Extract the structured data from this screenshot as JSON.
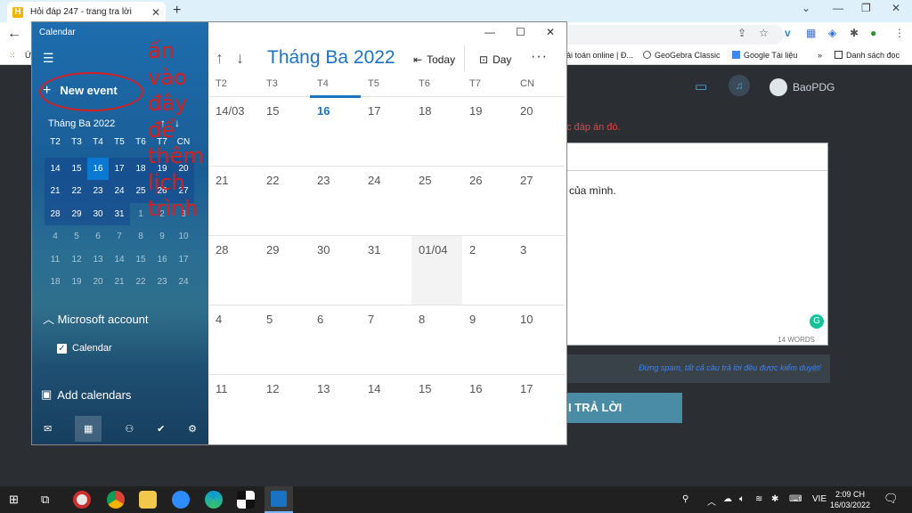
{
  "browser": {
    "tab_title": "Hỏi đáp 247 - trang tra lời",
    "bookmarks": [
      "Ứ",
      "ải toán online | Đ...",
      "GeoGebra Classic",
      "Google Tài liệu",
      "Danh sách đọc"
    ],
    "more_bookmarks": "»"
  },
  "website": {
    "username": "BaoPDG",
    "red_notice": "c đáp án đó.",
    "editor_text": "của mình.",
    "word_count": "14 WORDS",
    "spam_notice": "Đừng spam, tất cả câu trả lời đều được kiểm duyệt!",
    "submit_label": "I TRẢ LỜI"
  },
  "calendar": {
    "app_title": "Calendar",
    "new_event_label": "New event",
    "mini_month_title": "Tháng Ba 2022",
    "weekdays": [
      "T2",
      "T3",
      "T4",
      "T5",
      "T6",
      "T7",
      "CN"
    ],
    "mini_weeks": [
      [
        "14",
        "15",
        "16",
        "17",
        "18",
        "19",
        "20"
      ],
      [
        "21",
        "22",
        "23",
        "24",
        "25",
        "26",
        "27"
      ],
      [
        "28",
        "29",
        "30",
        "31",
        "1",
        "2",
        "3"
      ],
      [
        "4",
        "5",
        "6",
        "7",
        "8",
        "9",
        "10"
      ],
      [
        "11",
        "12",
        "13",
        "14",
        "15",
        "16",
        "17"
      ],
      [
        "18",
        "19",
        "20",
        "21",
        "22",
        "23",
        "24"
      ]
    ],
    "account_label": "Microsoft account",
    "calendar_item": "Calendar",
    "add_calendars": "Add calendars",
    "month_title": "Tháng Ba 2022",
    "today_label": "Today",
    "view_label": "Day",
    "more_label": "···",
    "month_weeks": [
      [
        "14/03",
        "15",
        "16",
        "17",
        "18",
        "19",
        "20"
      ],
      [
        "21",
        "22",
        "23",
        "24",
        "25",
        "26",
        "27"
      ],
      [
        "28",
        "29",
        "30",
        "31",
        "01/04",
        "2",
        "3"
      ],
      [
        "4",
        "5",
        "6",
        "7",
        "8",
        "9",
        "10"
      ],
      [
        "11",
        "12",
        "13",
        "14",
        "15",
        "16",
        "17"
      ]
    ],
    "annotation_lines": [
      "ấn",
      "vào",
      "đây",
      "để",
      "thêm",
      "lịch",
      "trình"
    ]
  },
  "taskbar": {
    "language": "VIE",
    "time": "2:09 CH",
    "date": "16/03/2022"
  },
  "colors": {
    "accent": "#1b73c8",
    "today": "#0b78d4",
    "annotation": "#d61f1f"
  }
}
